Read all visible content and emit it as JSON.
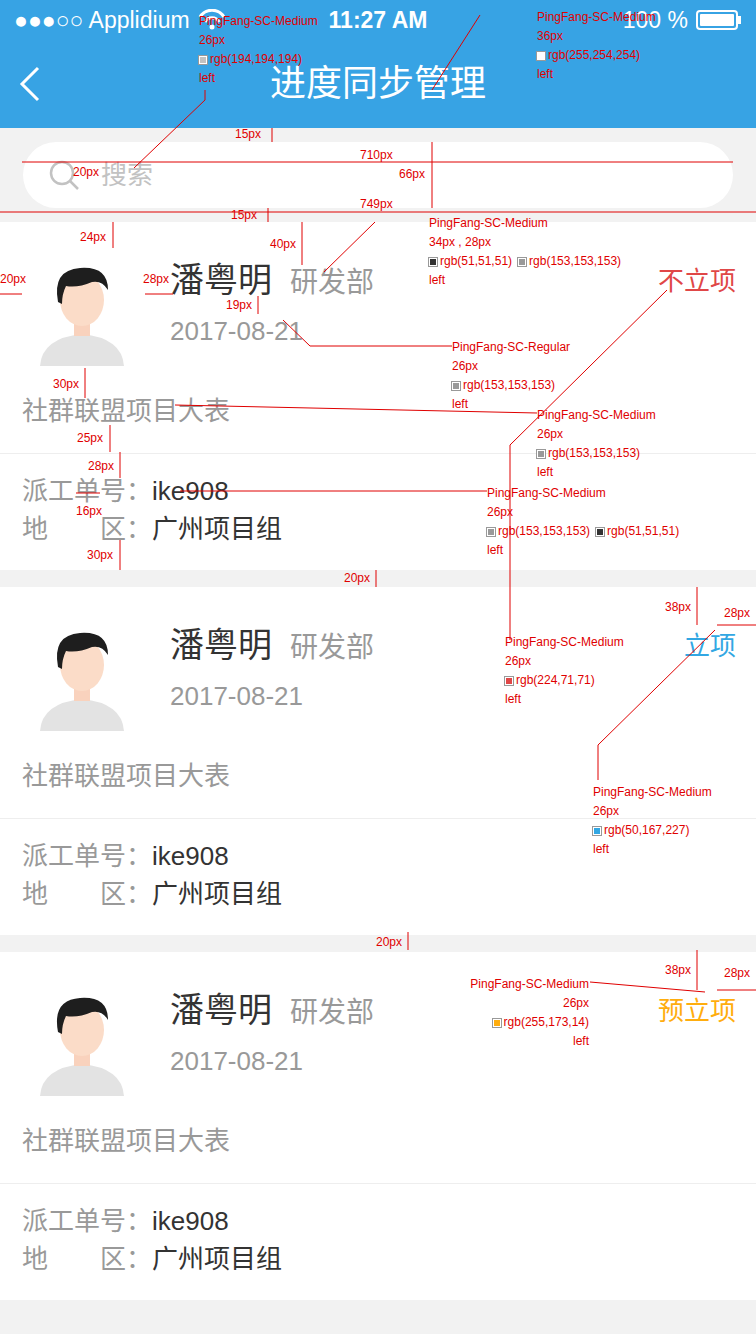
{
  "status_bar": {
    "carrier": "●●●○○ Applidium",
    "time": "11:27 AM",
    "battery": "100 %"
  },
  "nav": {
    "title": "进度同步管理"
  },
  "search": {
    "placeholder": "搜索"
  },
  "items": [
    {
      "name": "潘粤明",
      "dept": "研发部",
      "date": "2017-08-21",
      "project": "社群联盟项目大表",
      "order_label": "派工单号：",
      "order": "ike908",
      "region_label": "地　　区：",
      "region": "广州项目组",
      "status": "不立项",
      "color": "#e04747"
    },
    {
      "name": "潘粤明",
      "dept": "研发部",
      "date": "2017-08-21",
      "project": "社群联盟项目大表",
      "order_label": "派工单号：",
      "order": "ike908",
      "region_label": "地　　区：",
      "region": "广州项目组",
      "status": "立项",
      "color": "#32a7e3"
    },
    {
      "name": "潘粤明",
      "dept": "研发部",
      "date": "2017-08-21",
      "project": "社群联盟项目大表",
      "order_label": "派工单号：",
      "order": "ike908",
      "region_label": "地　　区：",
      "region": "广州项目组",
      "status": "预立项",
      "color": "#ffad0e"
    }
  ],
  "annotations": {
    "specs": [
      {
        "lines": [
          [
            {
              "text": "PingFang-SC-Medium"
            }
          ],
          [
            {
              "text": "26px"
            }
          ],
          [
            {
              "text": "rgb(194,194,194)",
              "color": "#c2c2c2"
            }
          ],
          [
            {
              "text": "left"
            }
          ]
        ]
      },
      {
        "lines": [
          [
            {
              "text": "PingFang-SC-Medium"
            }
          ],
          [
            {
              "text": "36px"
            }
          ],
          [
            {
              "text": "rgb(255,254,254)",
              "color": "#fffefe"
            }
          ],
          [
            {
              "text": "left"
            }
          ]
        ]
      },
      {
        "lines": [
          [
            {
              "text": "PingFang-SC-Medium"
            }
          ],
          [
            {
              "text": "34px , 28px"
            }
          ],
          [
            {
              "text": "rgb(51,51,51)",
              "color": "#333333"
            },
            {
              "text": "rgb(153,153,153)",
              "color": "#999999"
            }
          ],
          [
            {
              "text": "left"
            }
          ]
        ]
      },
      {
        "lines": [
          [
            {
              "text": "PingFang-SC-Regular"
            }
          ],
          [
            {
              "text": "26px"
            }
          ],
          [
            {
              "text": "rgb(153,153,153)",
              "color": "#999999"
            }
          ],
          [
            {
              "text": "left"
            }
          ]
        ]
      },
      {
        "lines": [
          [
            {
              "text": "PingFang-SC-Medium"
            }
          ],
          [
            {
              "text": "26px"
            }
          ],
          [
            {
              "text": "rgb(153,153,153)",
              "color": "#999999"
            }
          ],
          [
            {
              "text": "left"
            }
          ]
        ]
      },
      {
        "lines": [
          [
            {
              "text": "PingFang-SC-Medium"
            }
          ],
          [
            {
              "text": "26px"
            }
          ],
          [
            {
              "text": "rgb(153,153,153)",
              "color": "#999999"
            },
            {
              "text": "rgb(51,51,51)",
              "color": "#333333"
            }
          ],
          [
            {
              "text": "left"
            }
          ]
        ]
      },
      {
        "lines": [
          [
            {
              "text": "PingFang-SC-Medium"
            }
          ],
          [
            {
              "text": "26px"
            }
          ],
          [
            {
              "text": "rgb(224,71,71)",
              "color": "#e04747"
            }
          ],
          [
            {
              "text": "left"
            }
          ]
        ]
      },
      {
        "lines": [
          [
            {
              "text": "PingFang-SC-Medium"
            }
          ],
          [
            {
              "text": "26px"
            }
          ],
          [
            {
              "text": "rgb(50,167,227)",
              "color": "#32a7e3"
            }
          ],
          [
            {
              "text": "left"
            }
          ]
        ]
      },
      {
        "lines": [
          [
            {
              "text": "PingFang-SC-Medium"
            }
          ],
          [
            {
              "text": "26px"
            }
          ],
          [
            {
              "text": "rgb(255,173,14)",
              "color": "#ffad0e"
            }
          ],
          [
            {
              "text": "left"
            }
          ]
        ]
      }
    ],
    "dimensions": [
      "15px",
      "710px",
      "66px",
      "20px",
      "749px",
      "15px",
      "24px",
      "40px",
      "20px",
      "28px",
      "19px",
      "30px",
      "25px",
      "28px",
      "16px",
      "30px",
      "20px",
      "38px",
      "28px",
      "20px",
      "38px",
      "28px"
    ]
  }
}
